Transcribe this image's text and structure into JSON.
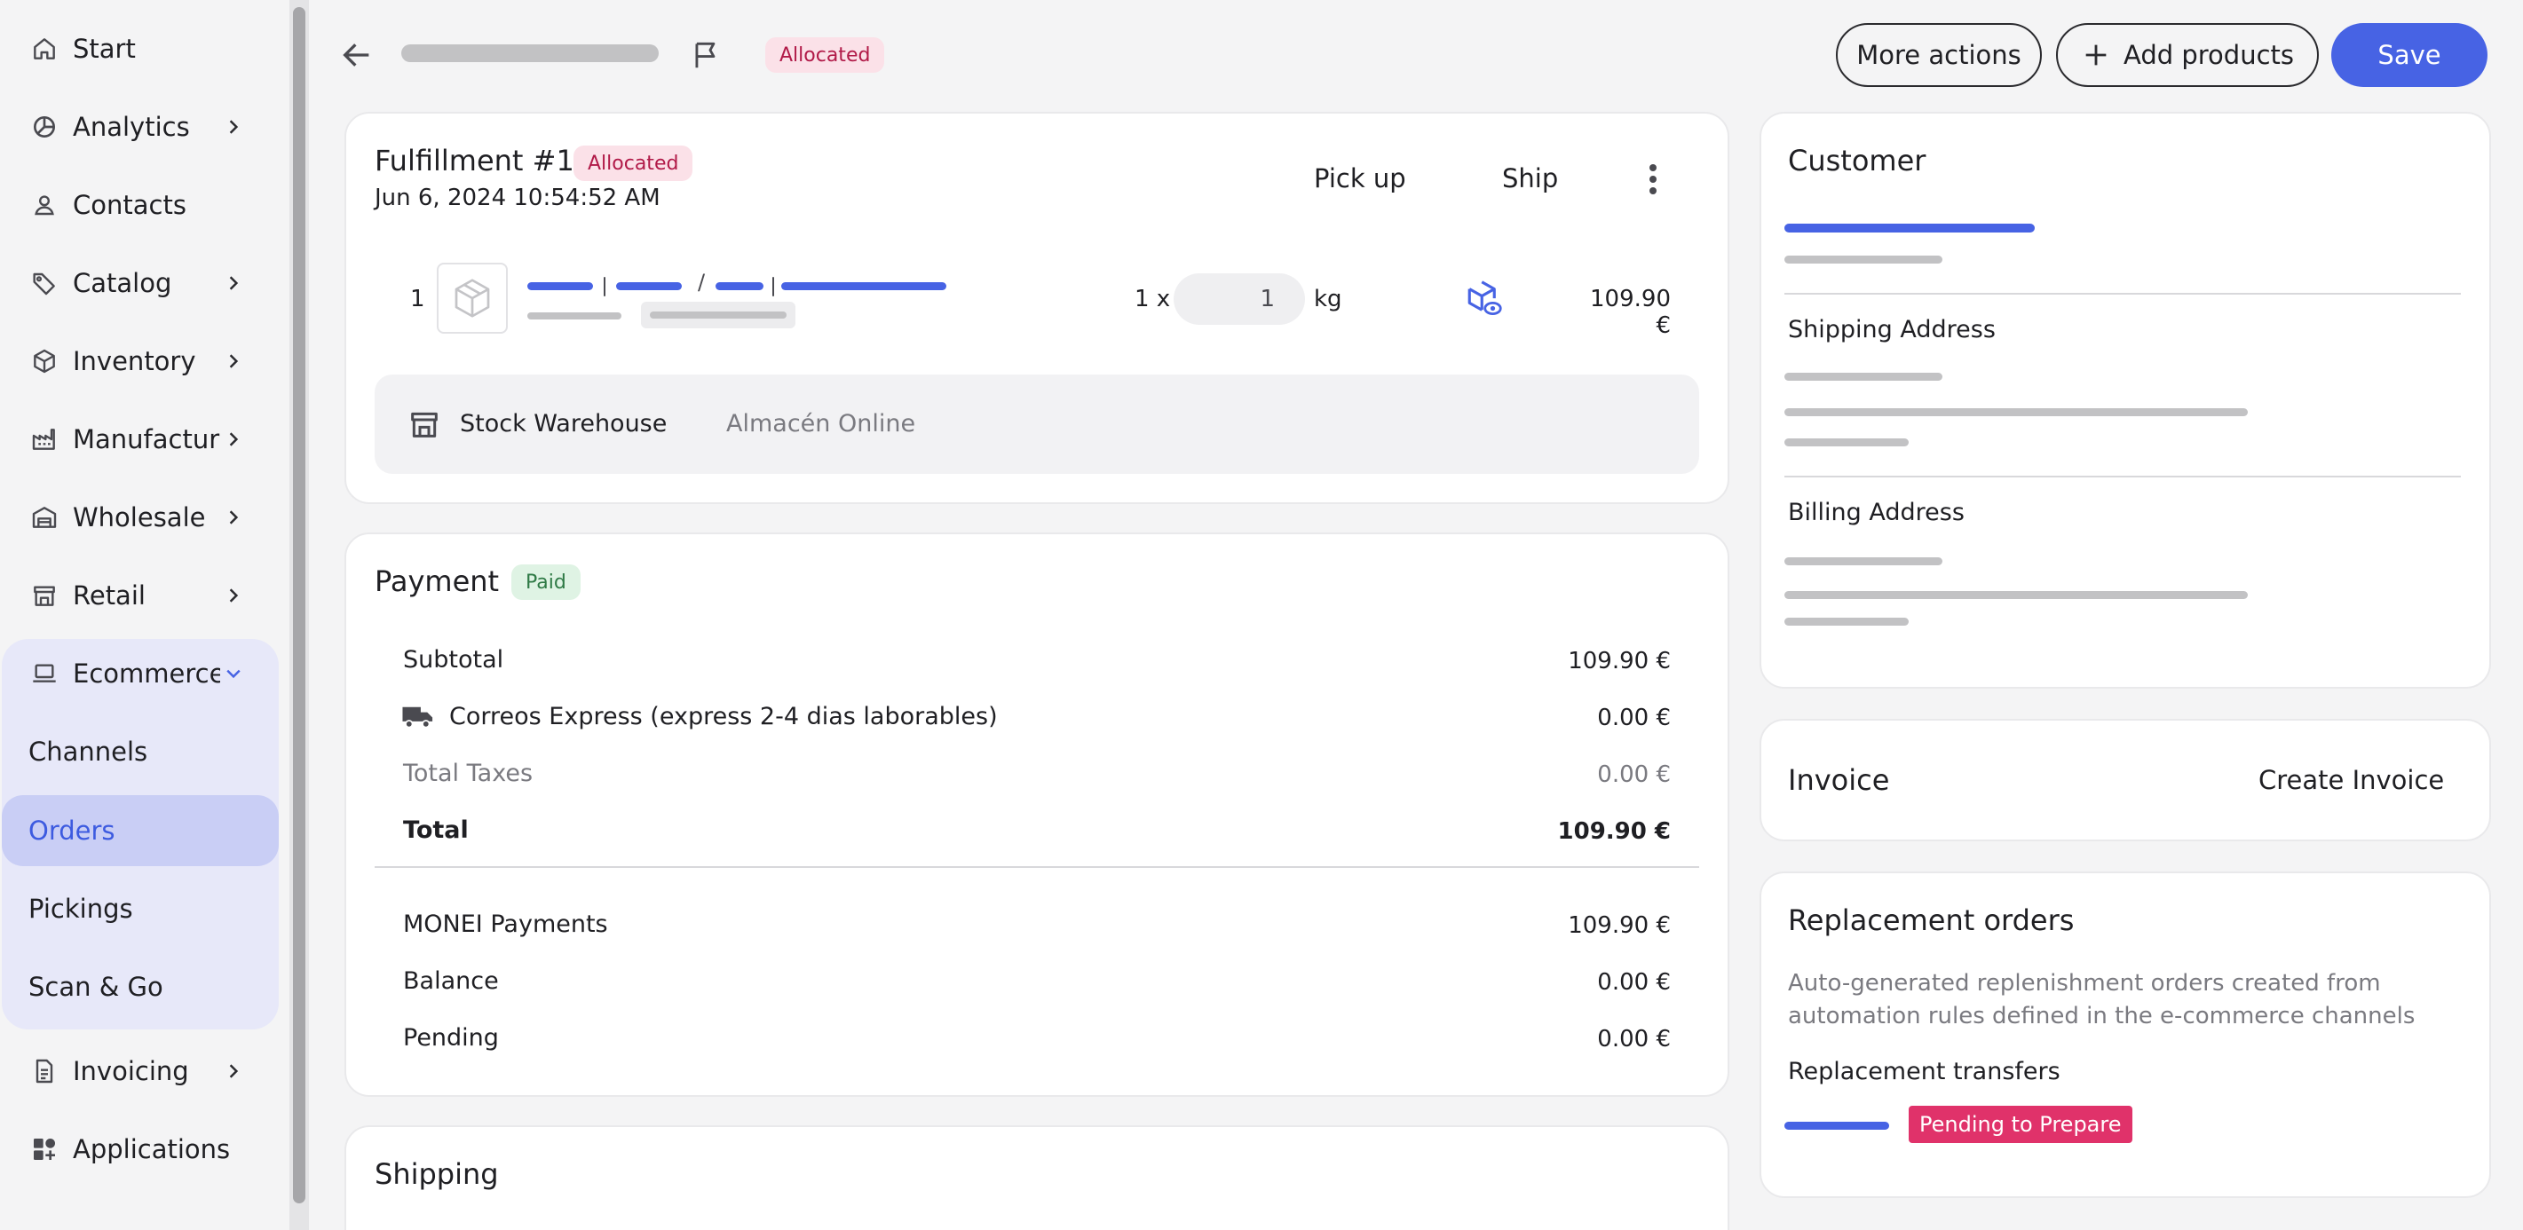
{
  "sidebar": {
    "items": [
      {
        "label": "Start",
        "icon": "home-icon",
        "chevron": false
      },
      {
        "label": "Analytics",
        "icon": "analytics-icon",
        "chevron": true
      },
      {
        "label": "Contacts",
        "icon": "contacts-icon",
        "chevron": false
      },
      {
        "label": "Catalog",
        "icon": "tag-icon",
        "chevron": true
      },
      {
        "label": "Inventory",
        "icon": "box-icon",
        "chevron": true
      },
      {
        "label": "Manufacturing",
        "icon": "factory-icon",
        "chevron": true
      },
      {
        "label": "Wholesale",
        "icon": "warehouse-icon",
        "chevron": true
      },
      {
        "label": "Retail",
        "icon": "store-icon",
        "chevron": true
      },
      {
        "label": "Ecommerce",
        "icon": "laptop-icon",
        "chevron": true,
        "expanded": true
      }
    ],
    "ecommerce_sub": [
      "Channels",
      "Orders",
      "Pickings",
      "Scan & Go"
    ],
    "active_sub": "Orders",
    "bottom_items": [
      {
        "label": "Invoicing",
        "icon": "document-icon",
        "chevron": true
      },
      {
        "label": "Applications",
        "icon": "apps-icon",
        "chevron": false
      }
    ]
  },
  "header": {
    "status_badge": "Allocated",
    "more_actions": "More actions",
    "add_products": "Add products",
    "save": "Save"
  },
  "fulfillment": {
    "title": "Fulfillment #1",
    "badge": "Allocated",
    "date": "Jun 6, 2024 10:54:52 AM",
    "pickup": "Pick up",
    "ship": "Ship",
    "line": {
      "index": "1",
      "qty_prefix": "1 x",
      "qty_value": "1",
      "unit": "kg",
      "price": "109.90 €"
    },
    "warehouse_label": "Stock Warehouse",
    "warehouse_value": "Almacén Online"
  },
  "payment": {
    "title": "Payment",
    "badge": "Paid",
    "rows": [
      {
        "label": "Subtotal",
        "value": "109.90 €"
      },
      {
        "label": "Correos Express (express 2-4 dias laborables)",
        "value": "0.00 €"
      },
      {
        "label": "Total Taxes",
        "value": "0.00 €"
      },
      {
        "label": "Total",
        "value": "109.90 €"
      }
    ],
    "rows2": [
      {
        "label": "MONEI Payments",
        "value": "109.90 €"
      },
      {
        "label": "Balance",
        "value": "0.00 €"
      },
      {
        "label": "Pending",
        "value": "0.00 €"
      }
    ]
  },
  "shipping": {
    "title": "Shipping"
  },
  "customer": {
    "title": "Customer",
    "shipping_address": "Shipping Address",
    "billing_address": "Billing Address"
  },
  "invoice": {
    "title": "Invoice",
    "create": "Create Invoice"
  },
  "replacement": {
    "title": "Replacement orders",
    "description": "Auto-generated replenishment orders created from automation rules defined in the e-commerce channels",
    "transfers_title": "Replacement transfers",
    "status": "Pending to Prepare"
  }
}
